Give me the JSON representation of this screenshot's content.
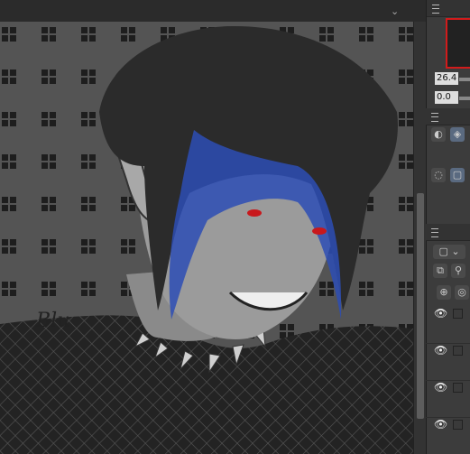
{
  "toolbar": {
    "collapse_icon": "chevron-down-icon"
  },
  "canvas": {
    "artwork_signature": "Blu",
    "colors": {
      "background": "#545454",
      "windows": "#1e1e1e",
      "hair": "#2b2b2b",
      "hair_highlight": "#2d4eb5",
      "shirt": "#1f1f1f",
      "eyes": "#c8181c"
    }
  },
  "navigator": {
    "zoom_value": "26.4",
    "rotate_value": "0.0"
  },
  "tool_property": {
    "icons": [
      "fill-icon",
      "layers-icon",
      "lasso-icon",
      "selection-icon"
    ]
  },
  "layers": {
    "icons": [
      "layers-icon",
      "blend-mode-select",
      "new-layer-icon",
      "new-folder-icon"
    ],
    "rows": [
      {
        "visible": true
      },
      {
        "visible": true
      },
      {
        "visible": true
      },
      {
        "visible": true
      }
    ]
  },
  "accent_color": "#d21b1b"
}
